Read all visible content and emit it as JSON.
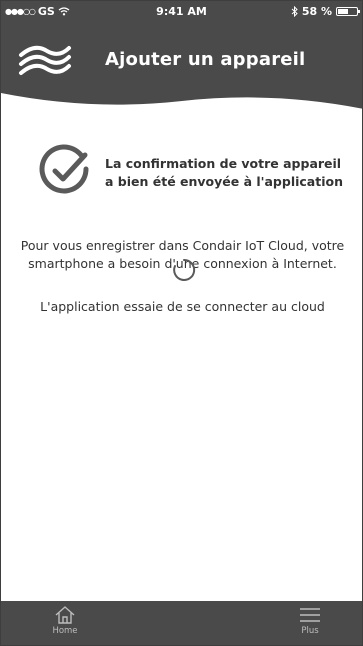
{
  "status_bar": {
    "carrier": "GS",
    "time": "9:41 AM",
    "battery_percent": "58 %",
    "battery_level": 0.58
  },
  "header": {
    "title": "Ajouter un appareil",
    "logo_icon": "condair-wave-logo"
  },
  "confirmation": {
    "line1": "La confirmation de votre appareil",
    "line2": "a bien été envoyée à l'application"
  },
  "info": {
    "line1": "Pour vous enregistrer dans Condair IoT Cloud, votre",
    "line2": "smartphone a besoin d'une connexion à Internet."
  },
  "connecting_text": "L'application essaie de se connecter au cloud",
  "tabbar": {
    "home_label": "Home",
    "plus_label": "Plus"
  },
  "colors": {
    "bar": "#4a4a4a",
    "text": "#333333",
    "icon_gray": "#5a5a5a"
  }
}
